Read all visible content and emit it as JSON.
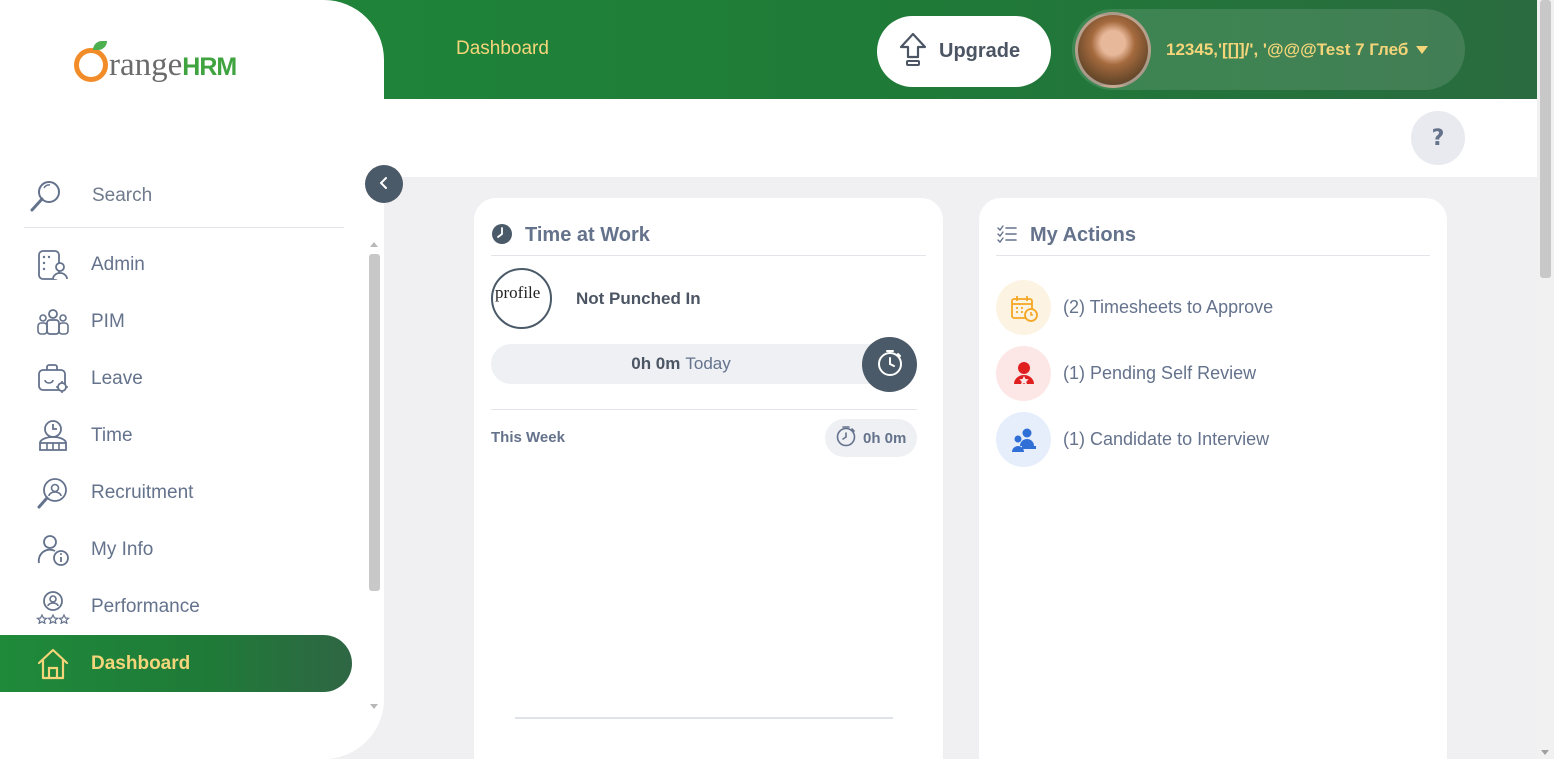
{
  "header": {
    "page_title": "Dashboard",
    "upgrade_label": "Upgrade",
    "user_name": "12345,'[[]]/', '@@@Test 7 Глеб"
  },
  "brand": {
    "part1": "range",
    "part2": "HRM"
  },
  "sidebar": {
    "search_placeholder": "Search",
    "items": [
      {
        "label": "Admin",
        "icon": "admin-icon"
      },
      {
        "label": "PIM",
        "icon": "pim-icon"
      },
      {
        "label": "Leave",
        "icon": "leave-icon"
      },
      {
        "label": "Time",
        "icon": "time-icon"
      },
      {
        "label": "Recruitment",
        "icon": "recruitment-icon"
      },
      {
        "label": "My Info",
        "icon": "my-info-icon"
      },
      {
        "label": "Performance",
        "icon": "performance-icon"
      },
      {
        "label": "Dashboard",
        "icon": "dashboard-icon",
        "active": true
      }
    ]
  },
  "help_label": "?",
  "time_at_work": {
    "title": "Time at Work",
    "profile_alt": "profile",
    "status": "Not Punched In",
    "today_value": "0h 0m",
    "today_label": "Today",
    "week_label": "This Week",
    "week_total": "0h 0m"
  },
  "my_actions": {
    "title": "My Actions",
    "items": [
      {
        "label": "(2) Timesheets to Approve",
        "icon": "timesheet-calendar-icon",
        "color": "#f5a623",
        "bg": "#fdf3e3"
      },
      {
        "label": "(1) Pending Self Review",
        "icon": "self-review-icon",
        "color": "#e02020",
        "bg": "#fde6e6"
      },
      {
        "label": "(1) Candidate to Interview",
        "icon": "candidate-interview-icon",
        "color": "#2f6fd6",
        "bg": "#e6eefc"
      }
    ]
  },
  "colors": {
    "brand_green": "#1f8a3a",
    "accent_yellow": "#f5d57a",
    "text_gray": "#64728c",
    "dark_slate": "#4b5a68"
  }
}
